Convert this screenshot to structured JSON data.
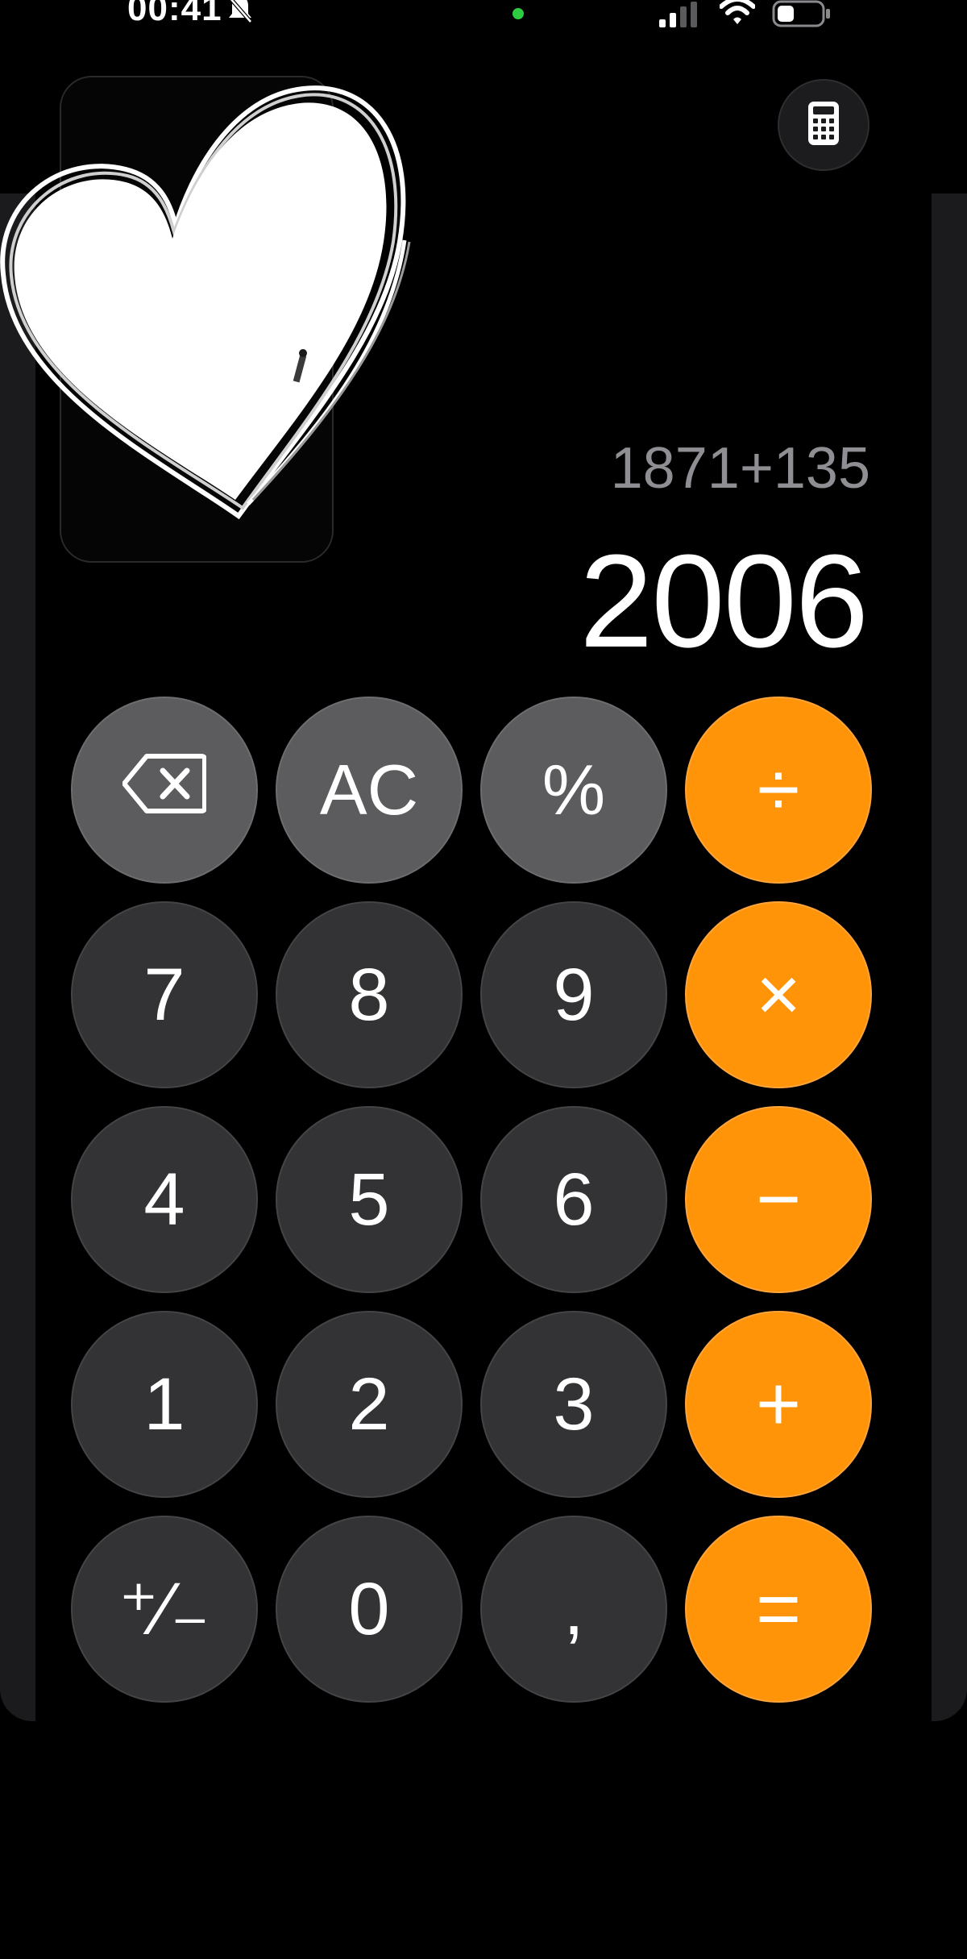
{
  "status_bar": {
    "time": "00:41",
    "icons": [
      "bell-slash-icon",
      "camera-indicator-dot",
      "cellular-signal-icon",
      "wifi-icon",
      "battery-icon"
    ]
  },
  "mode_button": {
    "icon": "calculator-icon"
  },
  "sticker": {
    "icon": "heart-sticker"
  },
  "display": {
    "expression": "1871+135",
    "result": "2006"
  },
  "keypad": {
    "rows": [
      [
        {
          "name": "backspace-key",
          "label": "",
          "icon": "backspace-icon",
          "kind": "func"
        },
        {
          "name": "all-clear-key",
          "label": "AC",
          "kind": "func"
        },
        {
          "name": "percent-key",
          "label": "%",
          "kind": "func"
        },
        {
          "name": "divide-key",
          "label": "÷",
          "kind": "op"
        }
      ],
      [
        {
          "name": "digit-7-key",
          "label": "7",
          "kind": "num"
        },
        {
          "name": "digit-8-key",
          "label": "8",
          "kind": "num"
        },
        {
          "name": "digit-9-key",
          "label": "9",
          "kind": "num"
        },
        {
          "name": "multiply-key",
          "label": "×",
          "kind": "op"
        }
      ],
      [
        {
          "name": "digit-4-key",
          "label": "4",
          "kind": "num"
        },
        {
          "name": "digit-5-key",
          "label": "5",
          "kind": "num"
        },
        {
          "name": "digit-6-key",
          "label": "6",
          "kind": "num"
        },
        {
          "name": "subtract-key",
          "label": "−",
          "kind": "op"
        }
      ],
      [
        {
          "name": "digit-1-key",
          "label": "1",
          "kind": "num"
        },
        {
          "name": "digit-2-key",
          "label": "2",
          "kind": "num"
        },
        {
          "name": "digit-3-key",
          "label": "3",
          "kind": "num"
        },
        {
          "name": "add-key",
          "label": "+",
          "kind": "op"
        }
      ],
      [
        {
          "name": "plus-minus-key",
          "label": "⁺∕₋",
          "kind": "num"
        },
        {
          "name": "digit-0-key",
          "label": "0",
          "kind": "num"
        },
        {
          "name": "decimal-comma-key",
          "label": ",",
          "kind": "num"
        },
        {
          "name": "equals-key",
          "label": "=",
          "kind": "op"
        }
      ]
    ]
  },
  "colors": {
    "background": "#000000",
    "operator": "#ff9409",
    "function_key": "#5c5c5e",
    "number_key": "#333335",
    "expression_text": "#8e8e93",
    "camera_dot": "#2ecc40"
  }
}
